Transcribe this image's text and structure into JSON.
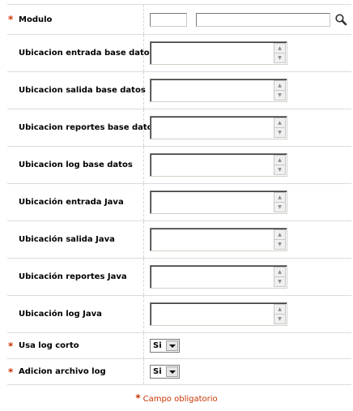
{
  "form": {
    "modulo": {
      "label": "Modulo",
      "required": true,
      "code_value": "",
      "name_value": ""
    },
    "text_areas": [
      {
        "label": "Ubicacion entrada base datos",
        "value": ""
      },
      {
        "label": "Ubicacion salida base datos",
        "value": ""
      },
      {
        "label": "Ubicacion reportes base datos",
        "value": ""
      },
      {
        "label": "Ubicacion log base datos",
        "value": ""
      },
      {
        "label": "Ubicación entrada Java",
        "value": ""
      },
      {
        "label": "Ubicación salida Java",
        "value": ""
      },
      {
        "label": "Ubicación reportes Java",
        "value": ""
      },
      {
        "label": "Ubicación log Java",
        "value": ""
      }
    ],
    "usa_log_corto": {
      "label": "Usa log corto",
      "required": true,
      "value": "Si"
    },
    "adicion_archivo_log": {
      "label": "Adicion archivo log",
      "required": true,
      "value": "Si"
    }
  },
  "required_marker": "*",
  "footer": {
    "required_note": "Campo obligatorio"
  },
  "colors": {
    "required": "#cc3300",
    "divider": "#dcdcdc"
  },
  "icons": {
    "lookup": "search-icon"
  }
}
